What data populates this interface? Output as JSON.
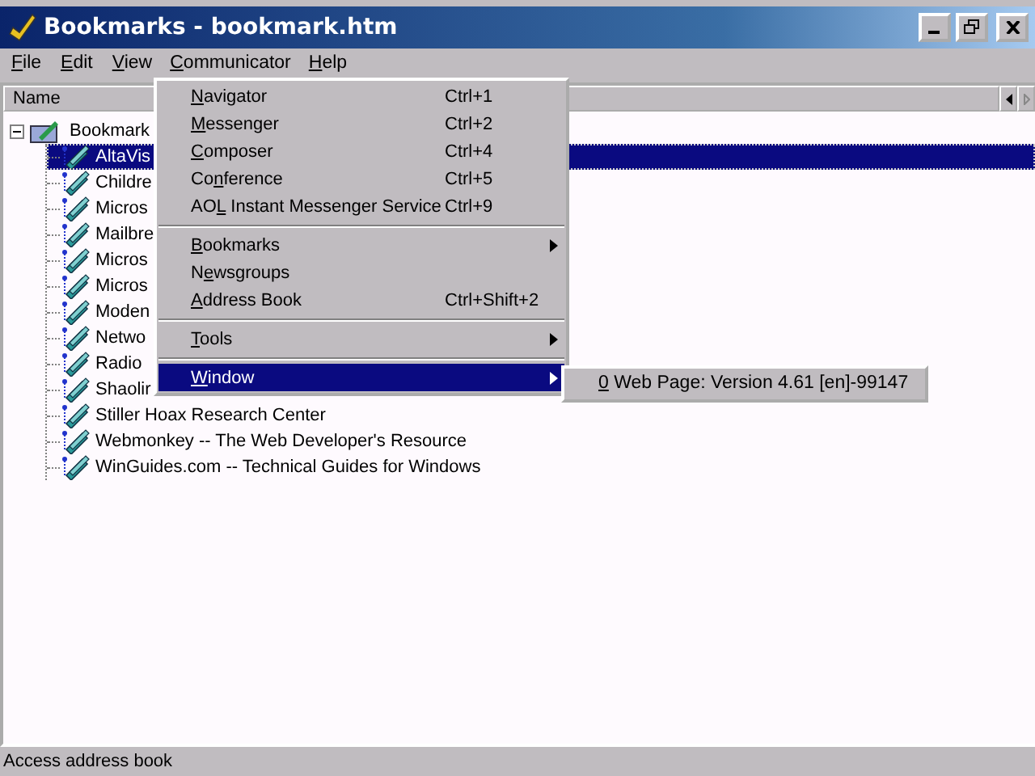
{
  "window": {
    "title": "Bookmarks - bookmark.htm"
  },
  "menu_bar": [
    {
      "access_key": "F",
      "label_after": "ile",
      "selected": false
    },
    {
      "access_key": "E",
      "label_after": "dit",
      "selected": false
    },
    {
      "access_key": "V",
      "label_after": "iew",
      "selected": false
    },
    {
      "access_key": "C",
      "label_after": "ommunicator",
      "selected": true
    },
    {
      "access_key": "H",
      "label_after": "elp",
      "selected": false
    }
  ],
  "columns": [
    "Name"
  ],
  "tree": {
    "label": "Bookmark",
    "expanded": true,
    "children": [
      {
        "label": "AltaVis",
        "selected": true
      },
      {
        "label": "Childre",
        "selected": false
      },
      {
        "label": "Micros",
        "selected": false
      },
      {
        "label": "Mailbre",
        "selected": false
      },
      {
        "label": "Micros",
        "selected": false
      },
      {
        "label": "Micros",
        "selected": false
      },
      {
        "label": "Moden",
        "selected": false
      },
      {
        "label": "Netwo",
        "selected": false
      },
      {
        "label": "Radio",
        "selected": false
      },
      {
        "label": "Shaolir",
        "selected": false
      },
      {
        "label": "Stiller Hoax Research Center",
        "selected": false
      },
      {
        "label": "Webmonkey -- The Web Developer's Resource",
        "selected": false
      },
      {
        "label": "WinGuides.com -- Technical Guides for Windows",
        "selected": false
      }
    ]
  },
  "dropdown": {
    "groups": [
      [
        {
          "access_key": "N",
          "label_after": "avigator",
          "shortcut": "Ctrl+1",
          "submenu": false,
          "selected": false
        },
        {
          "access_key": "M",
          "label_after": "essenger",
          "shortcut": "Ctrl+2",
          "submenu": false,
          "selected": false
        },
        {
          "access_key": "C",
          "label_after": "omposer",
          "shortcut": "Ctrl+4",
          "submenu": false,
          "selected": false
        },
        {
          "label_before": "Co",
          "access_key": "n",
          "label_after": "ference",
          "shortcut": "Ctrl+5",
          "submenu": false,
          "selected": false
        },
        {
          "label_before": "AO",
          "access_key": "L",
          "label_after": " Instant Messenger Service",
          "shortcut": "Ctrl+9",
          "submenu": false,
          "selected": false
        }
      ],
      [
        {
          "access_key": "B",
          "label_after": "ookmarks",
          "submenu": true,
          "selected": false
        },
        {
          "label_before": "N",
          "access_key": "e",
          "label_after": "wsgroups",
          "submenu": false,
          "selected": false
        },
        {
          "access_key": "A",
          "label_after": "ddress Book",
          "shortcut": "Ctrl+Shift+2",
          "submenu": false,
          "selected": false
        }
      ],
      [
        {
          "access_key": "T",
          "label_after": "ools",
          "submenu": true,
          "selected": false
        }
      ],
      [
        {
          "access_key": "W",
          "label_after": "indow",
          "submenu": true,
          "selected": true
        }
      ]
    ]
  },
  "submenu": {
    "items": [
      {
        "access_key": "0",
        "label_after": " Web Page: Version 4.61 [en]-99147"
      }
    ]
  },
  "status_bar": {
    "text": "Access address book"
  }
}
